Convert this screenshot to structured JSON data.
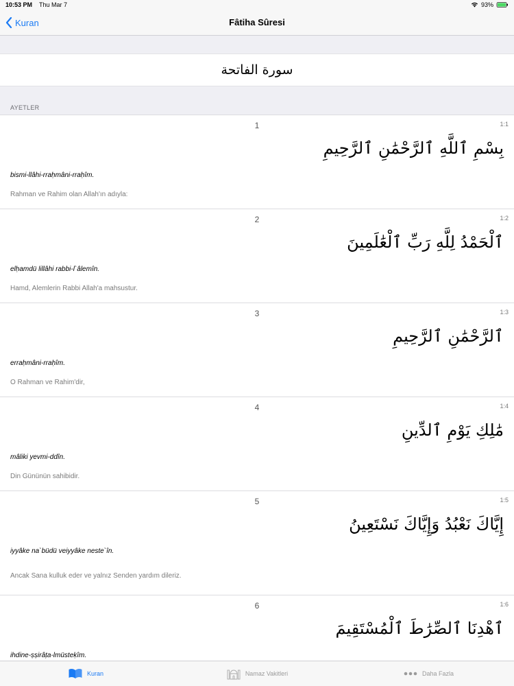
{
  "status": {
    "time": "10:53 PM",
    "date": "Thu Mar 7",
    "battery": "93%"
  },
  "nav": {
    "back_label": "Kuran",
    "title": "Fâtiha Sûresi"
  },
  "surah": {
    "arabic_name": "سورة الفاتحة"
  },
  "section_label": "AYETLER",
  "verses": [
    {
      "number": "1",
      "ref": "1:1",
      "arabic": "بِسْمِ ٱللَّهِ ٱلرَّحْمَٰنِ ٱلرَّحِيمِ",
      "translit": "bismi-llâhi-rraḥmâni-rraḥîm.",
      "meaning": "Rahman ve Rahim olan Allah'ın adıyla:"
    },
    {
      "number": "2",
      "ref": "1:2",
      "arabic": "ٱلْحَمْدُ لِلَّهِ رَبِّ ٱلْعَٰلَمِينَ",
      "translit": "elḥamdü lillâhi rabbi-l`âlemîn.",
      "meaning": "Hamd, Alemlerin Rabbi Allah'a mahsustur."
    },
    {
      "number": "3",
      "ref": "1:3",
      "arabic": "ٱلرَّحْمَٰنِ ٱلرَّحِيمِ",
      "translit": "erraḥmâni-rraḥîm.",
      "meaning": "O Rahman ve Rahim'dir,"
    },
    {
      "number": "4",
      "ref": "1:4",
      "arabic": "مَٰلِكِ يَوْمِ ٱلدِّينِ",
      "translit": "mâliki yevmi-ddîn.",
      "meaning": "Din Gününün sahibidir."
    },
    {
      "number": "5",
      "ref": "1:5",
      "arabic": "إِيَّاكَ نَعْبُدُ وَإِيَّاكَ نَسْتَعِينُ",
      "translit": "iyyâke na`büdü veiyyâke neste`în.",
      "meaning": "Ancak Sana kulluk eder ve yalnız Senden yardım dileriz."
    },
    {
      "number": "6",
      "ref": "1:6",
      "arabic": "ٱهْدِنَا ٱلصِّرَٰطَ ٱلْمُسْتَقِيمَ",
      "translit": "ihdine-ṣṣirâṭa-lmüsteḳîm.",
      "meaning": ""
    }
  ],
  "tabs": [
    {
      "label": "Kuran",
      "icon": "book-icon",
      "active": true
    },
    {
      "label": "Namaz Vakitleri",
      "icon": "mosque-icon",
      "active": false
    },
    {
      "label": "Daha Fazla",
      "icon": "more-dots-icon",
      "active": false
    }
  ],
  "colors": {
    "accent": "#1b7bf4",
    "battery_fill": "#4cd964"
  }
}
